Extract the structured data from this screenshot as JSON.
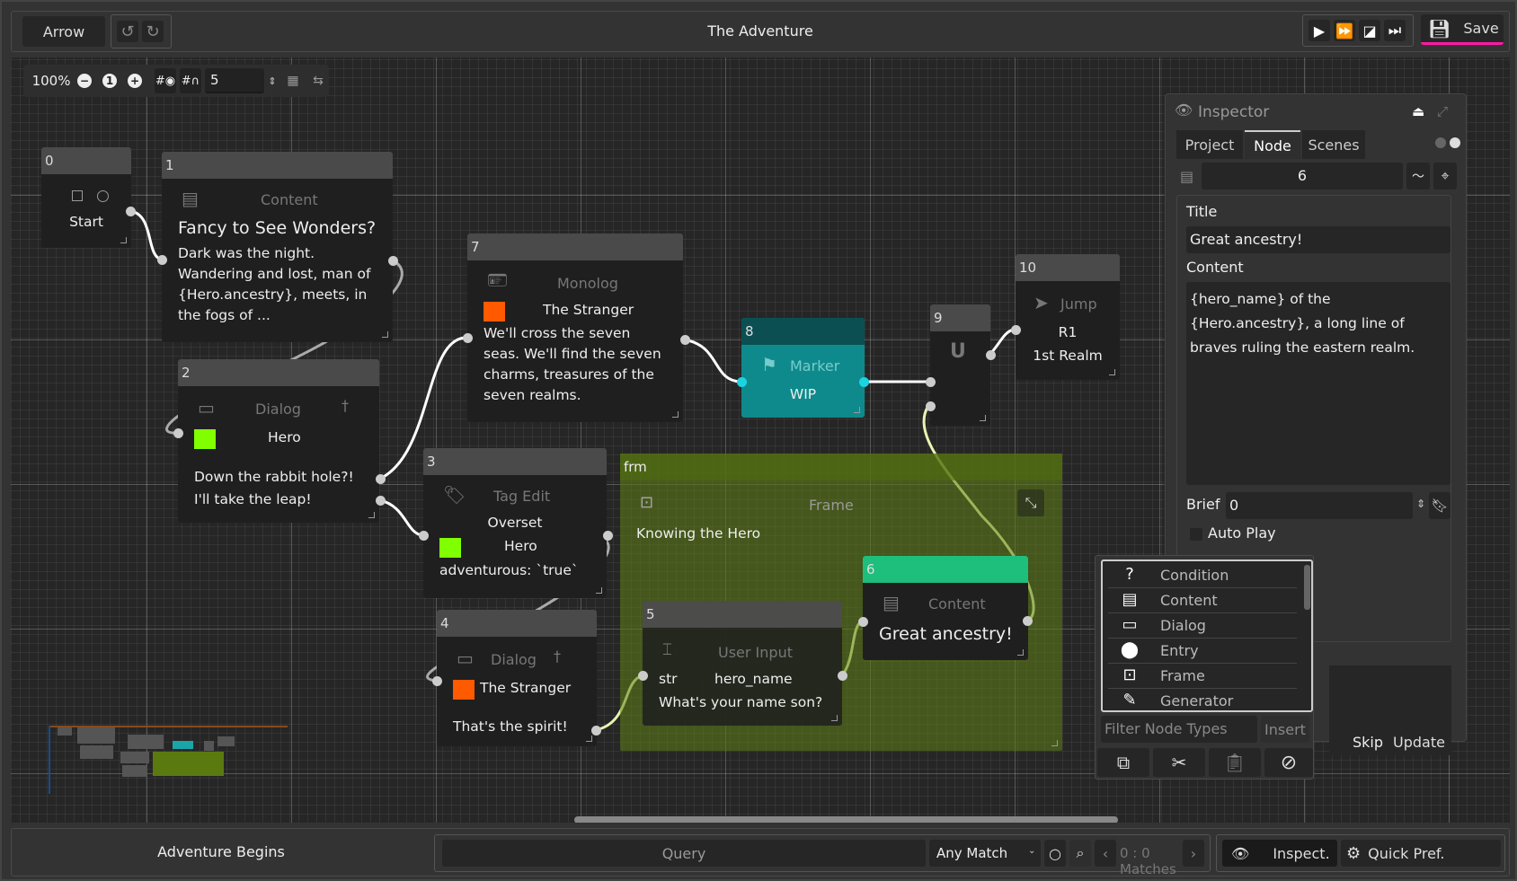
{
  "topbar": {
    "mode_label": "Arrow",
    "undo_icon": "undo-icon",
    "redo_icon": "redo-icon",
    "title": "The Adventure",
    "play_controls": [
      "play-icon",
      "fast-forward-icon",
      "play-from-icon",
      "skip-to-end-icon"
    ],
    "save_label": "Save",
    "save_accent": "#ff1aa8"
  },
  "canvas_toolbar": {
    "zoom": "100%",
    "zoom_out": "−",
    "zoom_reset": "1",
    "zoom_in": "+",
    "snap_value": "5"
  },
  "nodes": [
    {
      "id": "0",
      "type": "Start",
      "label": "Start"
    },
    {
      "id": "1",
      "type": "Content",
      "title": "Fancy to See Wonders?",
      "body": [
        "Dark was the night.",
        "Wandering and lost, man of",
        "{Hero.ancestry}, meets, in",
        "the fogs of ..."
      ]
    },
    {
      "id": "2",
      "type": "Dialog",
      "character": "Hero",
      "character_color": "#80ff00",
      "lines": [
        "Down the rabbit hole?!",
        "I'll take the leap!"
      ]
    },
    {
      "id": "3",
      "type": "Tag Edit",
      "action": "Overset",
      "character": "Hero",
      "character_color": "#80ff00",
      "tag": "adventurous: `true`"
    },
    {
      "id": "4",
      "type": "Dialog",
      "character": "The Stranger",
      "character_color": "#ff5a00",
      "lines": [
        "That's the spirit!"
      ]
    },
    {
      "id": "5",
      "type": "User Input",
      "var_type": "str",
      "var_name": "hero_name",
      "prompt": "What's your name son?"
    },
    {
      "id": "6",
      "type": "Content",
      "title": "Great ancestry!",
      "head_color": "#1ebe7c"
    },
    {
      "id": "7",
      "type": "Monolog",
      "character": "The Stranger",
      "character_color": "#ff5a00",
      "body": [
        "We'll cross the seven",
        "seas. We'll find the seven",
        "charms, treasures of the",
        "seven realms."
      ]
    },
    {
      "id": "8",
      "type": "Marker",
      "label": "WIP",
      "color": "#0e8c8c"
    },
    {
      "id": "9",
      "type": "Hub"
    },
    {
      "id": "10",
      "type": "Jump",
      "target": "R1",
      "target_name": "1st Realm"
    }
  ],
  "frame": {
    "id": "frm",
    "type": "Frame",
    "label": "Knowing the Hero",
    "color": "#5a7a10"
  },
  "inspector": {
    "title": "Inspector",
    "tabs": [
      "Project",
      "Node",
      "Scenes"
    ],
    "active_tab": "Node",
    "node_id": "6",
    "title_label": "Title",
    "title_value": "Great ancestry!",
    "content_label": "Content",
    "content_value": [
      "{hero_name} of the",
      "{Hero.ancestry}, a long line of",
      "braves ruling the eastern realm."
    ],
    "brief_label": "Brief",
    "brief_value": "0",
    "auto_play_label": "Auto Play",
    "auto_play": false,
    "skip_label": "Skip",
    "update_label": "Update"
  },
  "node_types_popup": {
    "items": [
      {
        "icon": "?",
        "label": "Condition"
      },
      {
        "icon": "▤",
        "label": "Content"
      },
      {
        "icon": "▭",
        "label": "Dialog"
      },
      {
        "icon": "⬤",
        "label": "Entry"
      },
      {
        "icon": "⊡",
        "label": "Frame"
      },
      {
        "icon": "✎",
        "label": "Generator"
      }
    ],
    "filter_placeholder": "Filter Node Types",
    "insert_label": "Insert"
  },
  "bottombar": {
    "scene_name": "Adventure Begins",
    "query_placeholder": "Query",
    "match_mode": "Any Match",
    "matches": "0 : 0 Matches",
    "inspect_label": "Inspect.",
    "quick_pref_label": "Quick Pref."
  }
}
